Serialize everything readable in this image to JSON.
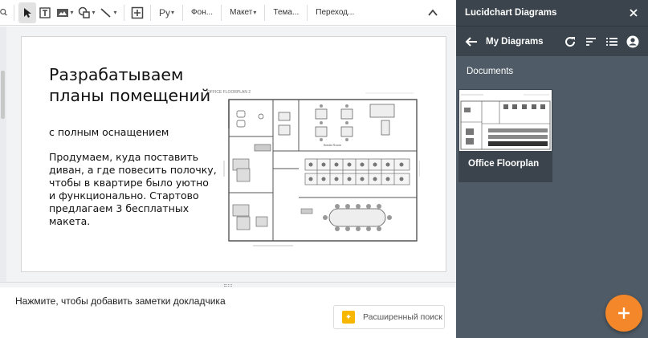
{
  "toolbar": {
    "items": {
      "background": "Фон...",
      "layout": "Макет",
      "theme": "Тема...",
      "transition": "Переход..."
    },
    "input_tool": "Ру"
  },
  "slide": {
    "title": "Разрабатываем планы помещений",
    "subtitle": "с полным оснащением",
    "body": "Продумаем, куда поставить диван, а где повесить полочку, чтобы в квартире было уютно и функционально. Стартово предлагаем 3 бесплатных макета."
  },
  "floorplan": {
    "label": "OFFICE FLOORPLAN 2",
    "room_label": "Break Room"
  },
  "notes": {
    "placeholder": "Нажмите, чтобы добавить заметки докладчика",
    "explore_label": "Расширенный поиск"
  },
  "sidebar": {
    "app_title": "Lucidchart Diagrams",
    "nav_title": "My Diagrams",
    "section_title": "Documents",
    "documents": [
      {
        "name": "Office Floorplan"
      }
    ]
  },
  "colors": {
    "sidebar_bg": "#4f5b66",
    "sidebar_header": "#3b444c",
    "fab": "#f4872a",
    "explore_icon": "#f7b600"
  },
  "icons": [
    "zoom-icon",
    "cursor-icon",
    "textbox-icon",
    "image-icon",
    "shape-icon",
    "line-icon",
    "add-comment-icon",
    "collapse-icon",
    "back-arrow-icon",
    "refresh-icon",
    "sort-icon",
    "list-view-icon",
    "account-icon",
    "add-icon",
    "explore-icon"
  ]
}
